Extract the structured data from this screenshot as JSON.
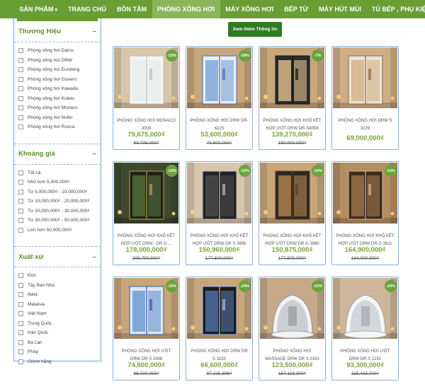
{
  "nav": {
    "items": [
      {
        "label": "SẢN PHẨM",
        "dropdown": true
      },
      {
        "label": "TRANG CHỦ"
      },
      {
        "label": "BỒN TẮM"
      },
      {
        "label": "PHÒNG XÔNG HƠI",
        "active": true
      },
      {
        "label": "MÁY XÔNG HƠI"
      },
      {
        "label": "BẾP TỪ"
      },
      {
        "label": "MÁY HÚT MÙI"
      },
      {
        "label": "TỦ BẾP , PHỤ KIỆN"
      }
    ]
  },
  "sidebar": {
    "brand": {
      "title": "Thương Hiệu",
      "toggle": "–",
      "options": [
        "Phòng xông hơi Daros",
        "Phòng xông hơi DRW",
        "Phòng xông hơi Euroking",
        "Phòng xông hơi Govern",
        "Phòng xông hơi Kawada",
        "Phòng xông hơi Koleto",
        "Phòng xông hơi Monaco",
        "Phòng xông hơi Nofer",
        "Phòng xông hơi Rosca"
      ]
    },
    "price": {
      "title": "Khoảng giá",
      "toggle": "–",
      "options": [
        "Tất cả",
        "Nhỏ hơn 5,000,000₫",
        "Từ 5,000,000₫ - 10,000,000₫",
        "Từ 10,000,000₫ - 20,000,000₫",
        "Từ 20,000,000₫ - 30,000,000₫",
        "Từ 30,000,000₫ - 50,000,000₫",
        "Lớn hơn 50,000,000₫"
      ]
    },
    "origin": {
      "title": "Xuất xứ",
      "toggle": "–",
      "options": [
        "Đức",
        "Tây Ban Nha",
        "Italia",
        "Malaisia",
        "Việt Nam",
        "Trung Quốc",
        "Hàn Quốc",
        "Ba Lan",
        "Pháp",
        "Chính hãng"
      ]
    }
  },
  "main": {
    "more_button": "Xem thêm Thông tin"
  },
  "products": [
    {
      "name": "PHÒNG XÔNG HƠI MONACO 3009",
      "price": "79,675,000₫",
      "old_price": "93,735,000₫",
      "discount": "-15%",
      "style": "white"
    },
    {
      "name": "PHÒNG XÔNG HƠI DRW DR-6225",
      "price": "53,600,000₫",
      "old_price": "74,800,000₫",
      "discount": "-28%",
      "style": "blue"
    },
    {
      "name": "PHÒNG XÔNG HƠI KHÔ KẾT HỢP ƯỚT DRW DR-S4058",
      "price": "139,270,000₫",
      "old_price": "150,000,000₫",
      "discount": "-7%",
      "style": "dark"
    },
    {
      "name": "PHÒNG XÔNG HƠI DRW S 3229",
      "price": "69,000,000₫",
      "old_price": "",
      "discount": "",
      "style": "wood"
    },
    {
      "name": "PHÒNG XÔNG HƠI KHÔ KẾT HỢP ƯỚT DRW - DR G ...",
      "price": "178,000,000₫",
      "old_price": "209,700,000₫",
      "discount": "-15%",
      "style": "darkgreen"
    },
    {
      "name": "PHÒNG XÔNG HƠI KHÔ KẾT HỢP ƯỚT DRW DR S 3856",
      "price": "150,960,000₫",
      "old_price": "177,600,000₫",
      "discount": "-15%",
      "style": "black"
    },
    {
      "name": "PHÒNG XÔNG HƠI KHÔ KẾT HỢP ƯỚT DRW DR G 3880",
      "price": "150,875,000₫",
      "old_price": "177,500,000₫",
      "discount": "-15%",
      "style": "woodstripe"
    },
    {
      "name": "PHÒNG XÔNG HƠI KHÔ KẾT HỢP ƯỚT DRW DR G 3911",
      "price": "164,900,000₫",
      "old_price": "194,000,000₫",
      "discount": "-15%",
      "style": "wooddark"
    },
    {
      "name": "PHÒNG XÔNG HƠI ƯỚT DRW DR S 2488",
      "price": "74,800,000₫",
      "old_price": "88,000,000₫",
      "discount": "-15%",
      "style": "bluelight"
    },
    {
      "name": "PHÒNG XÔNG HƠI DRW DR S 3220",
      "price": "66,600,000₫",
      "old_price": "87,215,896₫",
      "discount": "-24%",
      "style": "blackblue"
    },
    {
      "name": "PHÒNG XÔNG HƠI MASSAGE DRW DR S 2161",
      "price": "123,500,000₫",
      "old_price": "157,119,300₫",
      "discount": "-21%",
      "style": "tub"
    },
    {
      "name": "PHÒNG XÔNG HƠI ƯỚT DRW DR S 2151",
      "price": "93,300,000₫",
      "old_price": "115,433,000₫",
      "discount": "-19%",
      "style": "tubwhite"
    }
  ]
}
